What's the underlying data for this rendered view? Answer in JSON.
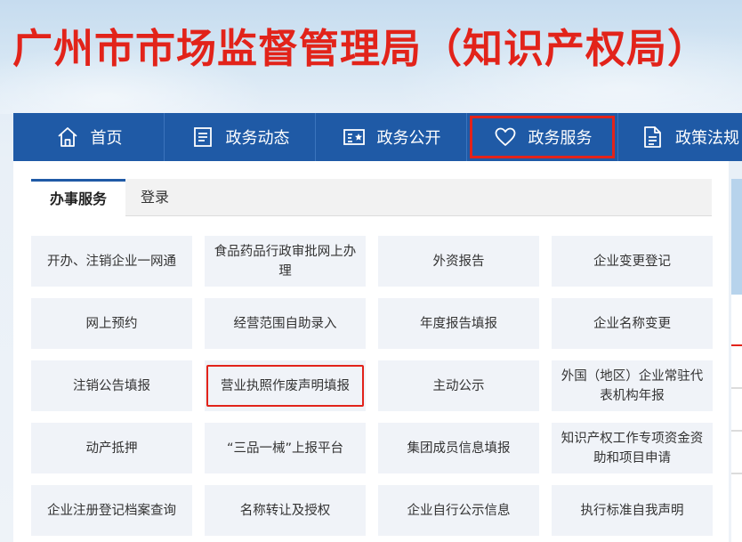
{
  "site": {
    "title": "广州市市场监督管理局（知识产权局）"
  },
  "nav": {
    "items": [
      {
        "label": "首页",
        "icon": "home-icon"
      },
      {
        "label": "政务动态",
        "icon": "news-list-icon"
      },
      {
        "label": "政务公开",
        "icon": "star-card-icon"
      },
      {
        "label": "政务服务",
        "icon": "heart-icon",
        "highlighted": true
      },
      {
        "label": "政策法规",
        "icon": "document-icon"
      }
    ]
  },
  "tabs": [
    {
      "label": "办事服务",
      "active": true
    },
    {
      "label": "登录",
      "active": false
    }
  ],
  "services": [
    [
      "开办、注销企业一网通",
      "食品药品行政审批网上办理",
      "外资报告",
      "企业变更登记"
    ],
    [
      "网上预约",
      "经营范围自助录入",
      "年度报告填报",
      "企业名称变更"
    ],
    [
      "注销公告填报",
      "营业执照作废声明填报",
      "主动公示",
      "外国（地区）企业常驻代表机构年报"
    ],
    [
      "动产抵押",
      "“三品一械”上报平台",
      "集团成员信息填报",
      "知识产权工作专项资金资助和项目申请"
    ],
    [
      "企业注册登记档案查询",
      "名称转让及授权",
      "企业自行公示信息",
      "执行标准自我声明"
    ]
  ],
  "highlighted_service": "营业执照作废声明填报",
  "colors": {
    "brand_red": "#e2231a",
    "nav_blue": "#1f5aa6",
    "cell_bg": "#f0f3f8"
  }
}
